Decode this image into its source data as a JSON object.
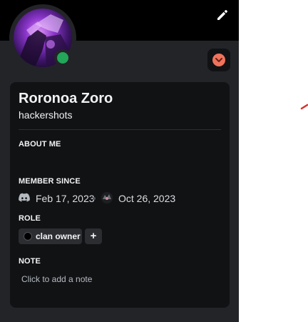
{
  "profile": {
    "display_name": "Roronoa Zoro",
    "username": "hackershots",
    "status": "online",
    "status_color": "#23a55a"
  },
  "sections": {
    "about_me_title": "ABOUT ME",
    "member_since_title": "MEMBER SINCE",
    "role_title": "ROLE",
    "note_title": "NOTE"
  },
  "member_since": {
    "discord_date": "Feb 17, 2023",
    "server_date": "Oct 26, 2023"
  },
  "roles": [
    {
      "label": "clan owner",
      "color": "#000000"
    }
  ],
  "role_add_label": "+",
  "note": {
    "placeholder": "Click to add a note"
  },
  "icons": {
    "edit": "pencil-icon",
    "badge": "chevron-down-badge-icon",
    "discord": "discord-icon",
    "server": "server-icon"
  },
  "colors": {
    "popout_bg": "#232428",
    "card_bg": "#111214",
    "banner": "#000000",
    "badge_accent": "#f0735c"
  }
}
